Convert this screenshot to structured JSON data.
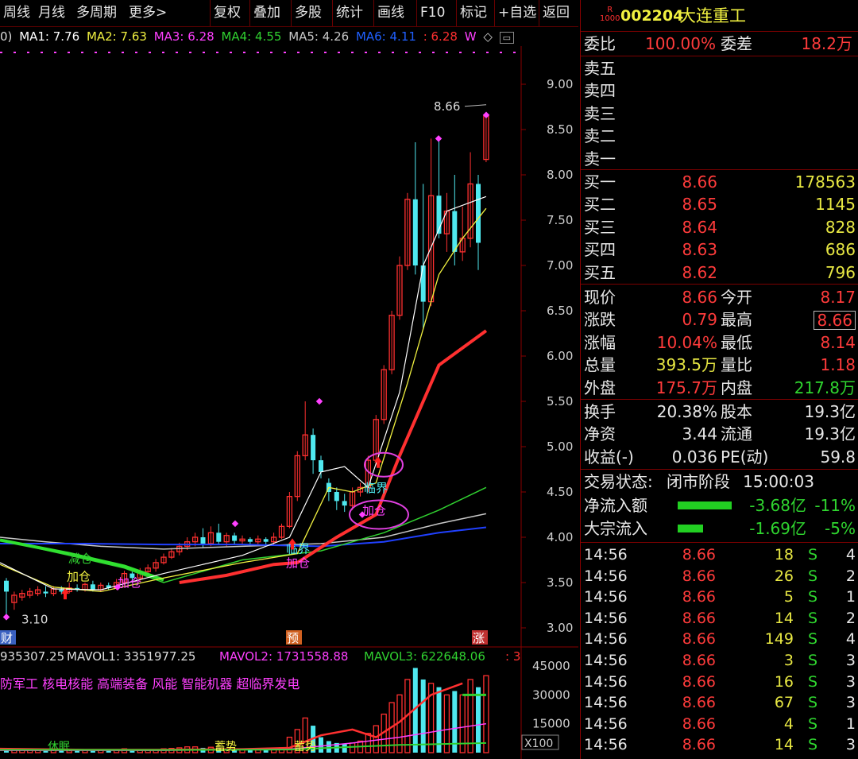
{
  "toolbar": {
    "items": [
      "周线",
      "月线",
      "多周期",
      "更多>",
      "复权",
      "叠加",
      "多股",
      "统计",
      "画线",
      "F10",
      "标记",
      "+自选",
      "返回"
    ]
  },
  "ma_line": {
    "prefix": "0)",
    "ma1": "MA1: 7.76",
    "ma2": "MA2: 7.63",
    "ma3": "MA3: 6.28",
    "ma4": "MA4: 4.55",
    "ma5": "MA5: 4.26",
    "ma6": "MA6: 4.11",
    "extra": ": 6.28",
    "w": "W"
  },
  "price_axis": [
    "9.00",
    "8.50",
    "8.00",
    "7.50",
    "7.00",
    "6.50",
    "6.00",
    "5.50",
    "5.00",
    "4.50",
    "4.00",
    "3.50",
    "3.00"
  ],
  "annotations": {
    "high": "8.66",
    "low": "3.10",
    "jianzu": "减仓",
    "jiacang1": "加仓",
    "jiacang2": "加仓",
    "jiacang3": "加仓",
    "linjie1": "临界",
    "linjie2": "临界",
    "jiacang4": "加仓",
    "badge_left": "财",
    "badge_mid": "预",
    "badge_right": "涨"
  },
  "volume": {
    "vol": "935307.25",
    "mavol1": "MAVOL1: 3351977.25",
    "mavol2": "MAVOL2: 1731558.88",
    "mavol3": "MAVOL3: 622648.06",
    "tail": ": 3",
    "concepts": "防军工 核电核能 高端装备 风能 智能机器 超临界发电",
    "axis": [
      "45000",
      "30000",
      "15000"
    ],
    "unit": "X100",
    "labels": [
      "休眠",
      "蓄势",
      "蓄势"
    ]
  },
  "panel": {
    "stock_badge_top": "R",
    "stock_badge_bottom": "1000",
    "code": "002204",
    "name": "大连重工",
    "weibi_label": "委比",
    "weibi": "100.00%",
    "weicha_label": "委差",
    "weicha": "18.2万",
    "sell": [
      {
        "label": "卖五"
      },
      {
        "label": "卖四"
      },
      {
        "label": "卖三"
      },
      {
        "label": "卖二"
      },
      {
        "label": "卖一"
      }
    ],
    "buy": [
      {
        "label": "买一",
        "price": "8.66",
        "vol": "178563"
      },
      {
        "label": "买二",
        "price": "8.65",
        "vol": "1145"
      },
      {
        "label": "买三",
        "price": "8.64",
        "vol": "828"
      },
      {
        "label": "买四",
        "price": "8.63",
        "vol": "686"
      },
      {
        "label": "买五",
        "price": "8.62",
        "vol": "796"
      }
    ],
    "quote": [
      {
        "l1": "现价",
        "v1": "8.66",
        "l2": "今开",
        "v2": "8.17"
      },
      {
        "l1": "涨跌",
        "v1": "0.79",
        "l2": "最高",
        "v2": "8.66"
      },
      {
        "l1": "涨幅",
        "v1": "10.04%",
        "l2": "最低",
        "v2": "8.14"
      },
      {
        "l1": "总量",
        "v1": "393.5万",
        "l2": "量比",
        "v2": "1.18"
      },
      {
        "l1": "外盘",
        "v1": "175.7万",
        "l2": "内盘",
        "v2": "217.8万"
      }
    ],
    "finance": [
      {
        "l1": "换手",
        "v1": "20.38%",
        "l2": "股本",
        "v2": "19.3亿"
      },
      {
        "l1": "净资",
        "v1": "3.44",
        "l2": "流通",
        "v2": "19.3亿"
      },
      {
        "l1": "收益(-)",
        "v1": "0.036",
        "l2": "PE(动)",
        "v2": "59.8"
      }
    ],
    "status_label": "交易状态:",
    "status": "闭市阶段",
    "status_time": "15:00:03",
    "netflow_label": "净流入额",
    "netflow": "-3.68亿",
    "netflow_pct": "-11%",
    "bigflow_label": "大宗流入",
    "bigflow": "-1.69亿",
    "bigflow_pct": "-5%",
    "ticks": [
      {
        "t": "14:56",
        "p": "8.66",
        "v": "18",
        "s": "S",
        "n": "4"
      },
      {
        "t": "14:56",
        "p": "8.66",
        "v": "26",
        "s": "S",
        "n": "2"
      },
      {
        "t": "14:56",
        "p": "8.66",
        "v": "5",
        "s": "S",
        "n": "1"
      },
      {
        "t": "14:56",
        "p": "8.66",
        "v": "14",
        "s": "S",
        "n": "2"
      },
      {
        "t": "14:56",
        "p": "8.66",
        "v": "149",
        "s": "S",
        "n": "4"
      },
      {
        "t": "14:56",
        "p": "8.66",
        "v": "3",
        "s": "S",
        "n": "3"
      },
      {
        "t": "14:56",
        "p": "8.66",
        "v": "16",
        "s": "S",
        "n": "3"
      },
      {
        "t": "14:56",
        "p": "8.66",
        "v": "67",
        "s": "S",
        "n": "3"
      },
      {
        "t": "14:56",
        "p": "8.66",
        "v": "4",
        "s": "S",
        "n": "1"
      },
      {
        "t": "14:56",
        "p": "8.66",
        "v": "14",
        "s": "S",
        "n": "3"
      }
    ]
  },
  "colors": {
    "up": "#ff3030",
    "down": "#4fe8ef",
    "ma1": "#ffffff",
    "ma2": "#f0f040",
    "ma3": "#ff3030",
    "ma4": "#30d030",
    "ma5": "#c8c8c8",
    "ma6": "#2040ff",
    "magenta": "#ff40ff"
  }
}
